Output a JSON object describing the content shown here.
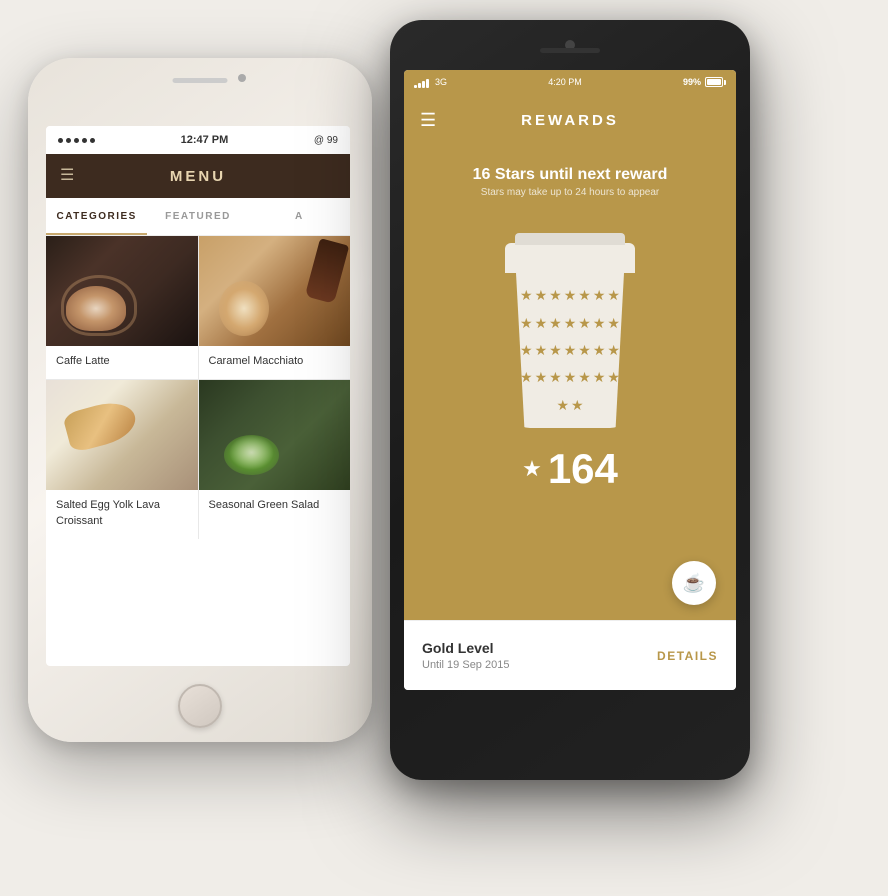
{
  "iphone": {
    "status": {
      "dots": 5,
      "time": "12:47 PM",
      "battery": "99"
    },
    "header": {
      "menu_icon": "☰",
      "title": "MENU"
    },
    "tabs": [
      {
        "label": "CATEGORIES",
        "active": true
      },
      {
        "label": "FEATURED",
        "active": false
      },
      {
        "label": "A",
        "active": false
      }
    ],
    "items": [
      {
        "name": "Caffe Latte",
        "img_type": "latte"
      },
      {
        "name": "Caramel Macchiato",
        "img_type": "macchiato"
      },
      {
        "name": "Salted Egg Yolk Lava Croissant",
        "img_type": "croissant"
      },
      {
        "name": "Seasonal Green Salad",
        "img_type": "salad"
      }
    ]
  },
  "android": {
    "status": {
      "network": "3G",
      "time": "4:20 PM",
      "battery_pct": "99%"
    },
    "header": {
      "menu_icon": "☰",
      "title": "REWARDS"
    },
    "rewards": {
      "stars_until": "16 Stars until next reward",
      "stars_sub": "Stars may take up to 24 hours to appear",
      "count": "164",
      "star_icon": "★",
      "cup_stars_count": 30
    },
    "bottom": {
      "level": "Gold Level",
      "until": "Until 19 Sep 2015",
      "details_btn": "DETAILS"
    }
  }
}
